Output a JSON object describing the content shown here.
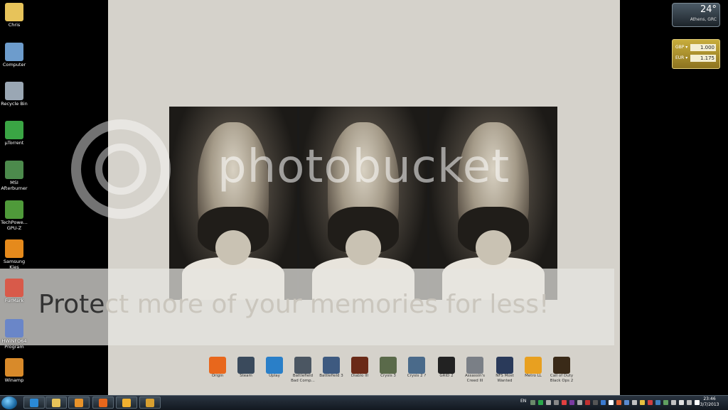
{
  "desktop": {
    "icons": [
      {
        "label": "Chris",
        "icon": "folder-icon",
        "color": "#e7c35a"
      },
      {
        "label": "Computer",
        "icon": "computer-icon",
        "color": "#6d9ccc"
      },
      {
        "label": "Recycle Bin",
        "icon": "recycle-bin-icon",
        "color": "#9aa7b4"
      },
      {
        "label": "µTorrent",
        "icon": "utorrent-icon",
        "color": "#3aa544"
      },
      {
        "label": "MSI Afterburner",
        "icon": "msi-afterburner-icon",
        "color": "#4c8a4c"
      },
      {
        "label": "TechPowe... GPU-Z",
        "icon": "gpu-z-icon",
        "color": "#4f9a3a"
      },
      {
        "label": "Samsung Kies",
        "icon": "samsung-kies-icon",
        "color": "#e58a1c"
      },
      {
        "label": "FurMark",
        "icon": "furmark-icon",
        "color": "#d85a4a"
      },
      {
        "label": "HWiNFO64 Program",
        "icon": "hwinfo-icon",
        "color": "#6a86c8"
      },
      {
        "label": "Winamp",
        "icon": "winamp-icon",
        "color": "#d88a2a"
      }
    ]
  },
  "watermark": {
    "logo_text": "photobucket",
    "protect_prefix": "Prote",
    "protect_rest": "ct more of your memories for less!"
  },
  "gadgets": {
    "weather": {
      "temperature": "24°",
      "city": "Athens, GRC"
    },
    "currency": [
      {
        "code": "GBP ▾",
        "value": "1.000"
      },
      {
        "code": "EUR ▾",
        "value": "1.175"
      }
    ]
  },
  "dock": {
    "items": [
      {
        "label": "Origin",
        "icon": "origin-icon",
        "color": "#e8671c"
      },
      {
        "label": "Steam",
        "icon": "steam-icon",
        "color": "#3a4a5c"
      },
      {
        "label": "Uplay",
        "icon": "uplay-icon",
        "color": "#2a7fc8"
      },
      {
        "label": "Battlefield Bad Comp...",
        "icon": "battlefield-bc-icon",
        "color": "#4b5662"
      },
      {
        "label": "Battlefield 3",
        "icon": "battlefield-3-icon",
        "color": "#3e5a80"
      },
      {
        "label": "Diablo III",
        "icon": "diablo-iii-icon",
        "color": "#6a2a18"
      },
      {
        "label": "Crysis 3",
        "icon": "crysis-3-icon",
        "color": "#5a6a4a"
      },
      {
        "label": "Crysis 2 ?",
        "icon": "crysis-2-icon",
        "color": "#4a6a8a"
      },
      {
        "label": "GRID 2",
        "icon": "grid-2-icon",
        "color": "#222222"
      },
      {
        "label": "Assassin's Creed III",
        "icon": "assassins-creed-icon",
        "color": "#7a7f86"
      },
      {
        "label": "NFS Most Wanted",
        "icon": "nfs-icon",
        "color": "#2a3a5a"
      },
      {
        "label": "Metro LL",
        "icon": "metro-icon",
        "color": "#e8a020"
      },
      {
        "label": "Call of Duty Black Ops 2",
        "icon": "call-of-duty-icon",
        "color": "#3a2a18"
      }
    ]
  },
  "taskbar": {
    "pinned": [
      {
        "name": "internet-explorer-icon",
        "color": "#2a8ad8"
      },
      {
        "name": "explorer-folder-icon",
        "color": "#e7c35a"
      },
      {
        "name": "media-player-icon",
        "color": "#e8932a"
      },
      {
        "name": "firefox-icon",
        "color": "#e8671c"
      },
      {
        "name": "outlook-icon",
        "color": "#f0b030"
      },
      {
        "name": "winamp-taskbar-icon",
        "color": "#d8a030"
      }
    ],
    "language": "EN",
    "tray_colors": [
      "#6a8a6a",
      "#2aa84a",
      "#aaaaaa",
      "#888888",
      "#e04040",
      "#7a3aa0",
      "#aaaaaa",
      "#c03030",
      "#555555",
      "#3a7ad0",
      "#ffffff",
      "#e06030",
      "#5a8ad0",
      "#c0c0c0",
      "#e8c040",
      "#d04040",
      "#4080c0",
      "#60a060",
      "#c0c0c0",
      "#e0e0e0",
      "#c0c0c0",
      "#ffffff"
    ],
    "clock_time": "23:46",
    "clock_date": "3/7/2013"
  }
}
